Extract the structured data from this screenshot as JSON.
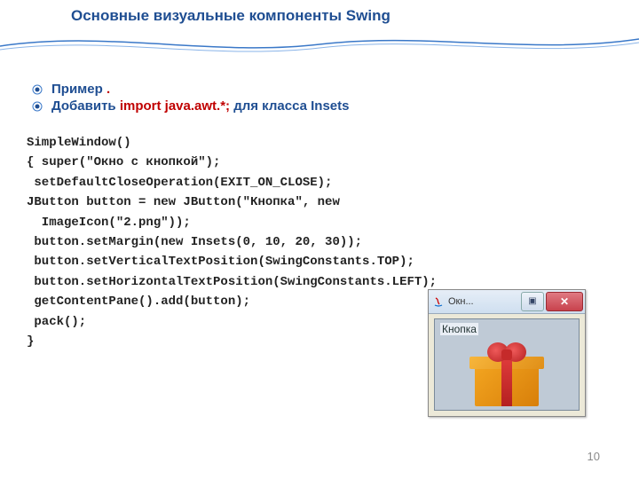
{
  "title": "Основные визуальные компоненты Swing",
  "bullets": [
    {
      "pre": "Пример ",
      "mid": "",
      "post": ".",
      "preClass": "blue",
      "postClass": "dkred"
    },
    {
      "pre": "Добавить ",
      "mid": "import java.awt.*;",
      "post": " для класса Insets",
      "preClass": "blue",
      "midClass": "red",
      "postClass": "blue"
    }
  ],
  "code": [
    "SimpleWindow()",
    "{ super(\"Окно с кнопкой\");",
    " setDefaultCloseOperation(EXIT_ON_CLOSE);",
    "JButton button = new JButton(\"Кнопка\", new",
    "  ImageIcon(\"2.png\"));",
    " button.setMargin(new Insets(0, 10, 20, 30));",
    " button.setVerticalTextPosition(SwingConstants.TOP);",
    " button.setHorizontalTextPosition(SwingConstants.LEFT);",
    " getContentPane().add(button);",
    " pack();",
    "}"
  ],
  "window": {
    "title_fragment": "Окн...",
    "button_label": "Кнопка",
    "close": "✕",
    "min": "▣"
  },
  "page_number": "10"
}
